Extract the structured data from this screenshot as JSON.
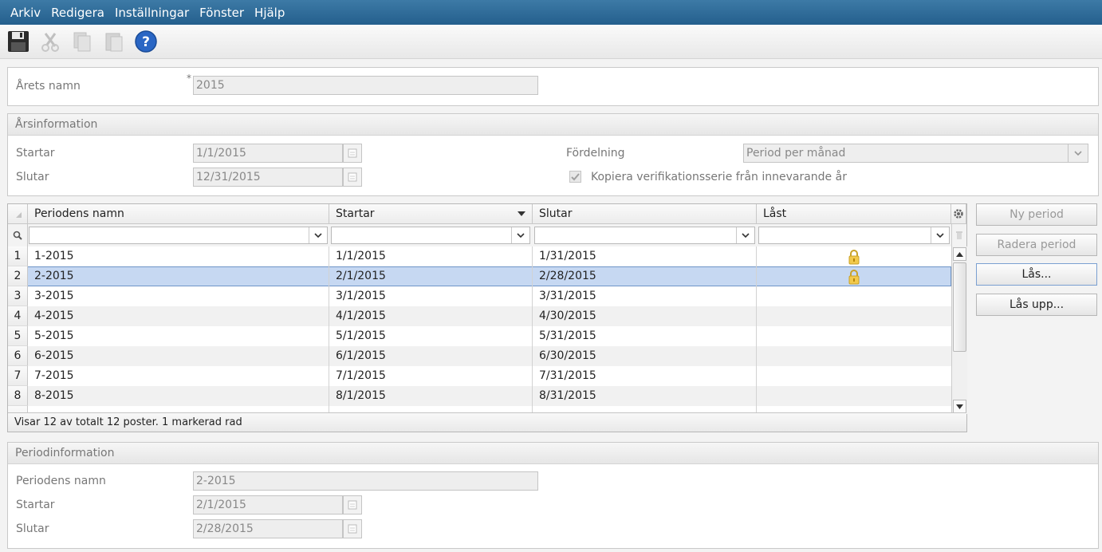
{
  "menu": [
    "Arkiv",
    "Redigera",
    "Inställningar",
    "Fönster",
    "Hjälp"
  ],
  "toolbar": {
    "icons": [
      "save-icon",
      "cut-icon",
      "copy-icon",
      "paste-icon",
      "help-icon"
    ]
  },
  "year": {
    "label": "Årets namn",
    "required_mark": "*",
    "value": "2015"
  },
  "year_info": {
    "title": "Årsinformation",
    "start_label": "Startar",
    "start_value": "1/1/2015",
    "end_label": "Slutar",
    "end_value": "12/31/2015",
    "distribution_label": "Fördelning",
    "distribution_value": "Period per månad",
    "copy_series_label": "Kopiera verifikationsserie från innevarande år",
    "copy_series_checked": true
  },
  "grid": {
    "columns": [
      "Periodens namn",
      "Startar",
      "Slutar",
      "Låst"
    ],
    "rows": [
      {
        "n": "1",
        "name": "1-2015",
        "start": "1/1/2015",
        "end": "1/31/2015",
        "locked": true
      },
      {
        "n": "2",
        "name": "2-2015",
        "start": "2/1/2015",
        "end": "2/28/2015",
        "locked": true
      },
      {
        "n": "3",
        "name": "3-2015",
        "start": "3/1/2015",
        "end": "3/31/2015",
        "locked": false
      },
      {
        "n": "4",
        "name": "4-2015",
        "start": "4/1/2015",
        "end": "4/30/2015",
        "locked": false
      },
      {
        "n": "5",
        "name": "5-2015",
        "start": "5/1/2015",
        "end": "5/31/2015",
        "locked": false
      },
      {
        "n": "6",
        "name": "6-2015",
        "start": "6/1/2015",
        "end": "6/30/2015",
        "locked": false
      },
      {
        "n": "7",
        "name": "7-2015",
        "start": "7/1/2015",
        "end": "7/31/2015",
        "locked": false
      },
      {
        "n": "8",
        "name": "8-2015",
        "start": "8/1/2015",
        "end": "8/31/2015",
        "locked": false
      }
    ],
    "selected_row": 2,
    "status": "Visar 12 av totalt 12 poster. 1 markerad rad"
  },
  "buttons": {
    "new_period": "Ny period",
    "delete_period": "Radera period",
    "lock": "Lås...",
    "unlock": "Lås upp..."
  },
  "period_info": {
    "title": "Periodinformation",
    "name_label": "Periodens namn",
    "name_value": "2-2015",
    "start_label": "Startar",
    "start_value": "2/1/2015",
    "end_label": "Slutar",
    "end_value": "2/28/2015"
  }
}
